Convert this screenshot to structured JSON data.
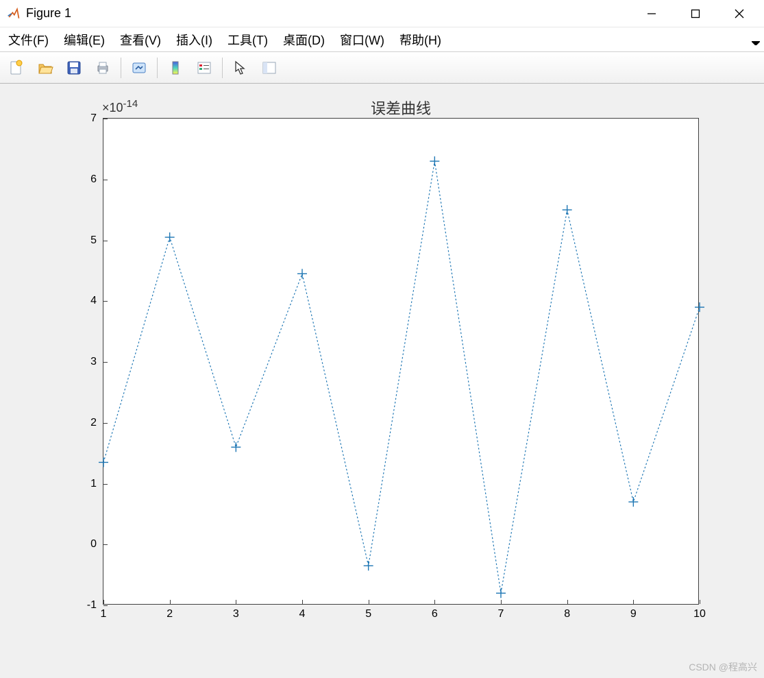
{
  "window": {
    "title": "Figure 1"
  },
  "menu": {
    "file": "文件(F)",
    "edit": "编辑(E)",
    "view": "查看(V)",
    "insert": "插入(I)",
    "tools": "工具(T)",
    "desktop": "桌面(D)",
    "window": "窗口(W)",
    "help": "帮助(H)"
  },
  "toolbar": {
    "new": "new-figure-icon",
    "open": "open-icon",
    "save": "save-icon",
    "print": "print-icon",
    "link": "link-icon",
    "colorbar": "colorbar-icon",
    "legend": "legend-icon",
    "edit_plot": "pointer-icon",
    "data_cursor": "data-cursor-icon"
  },
  "chart_data": {
    "type": "line",
    "title": "误差曲线",
    "y_exponent_label": "×10",
    "y_exponent_sup": "-14",
    "x": [
      1,
      2,
      3,
      4,
      5,
      6,
      7,
      8,
      9,
      10
    ],
    "values": [
      1.35,
      5.05,
      1.6,
      4.45,
      -0.35,
      6.3,
      -0.8,
      5.5,
      0.7,
      3.9
    ],
    "xlim": [
      1,
      10
    ],
    "ylim": [
      -1,
      7
    ],
    "xticks": [
      1,
      2,
      3,
      4,
      5,
      6,
      7,
      8,
      9,
      10
    ],
    "yticks": [
      -1,
      0,
      1,
      2,
      3,
      4,
      5,
      6,
      7
    ],
    "marker": "+",
    "line_style": "dotted",
    "color": "#1f77b4"
  },
  "watermark": "CSDN @程高兴"
}
